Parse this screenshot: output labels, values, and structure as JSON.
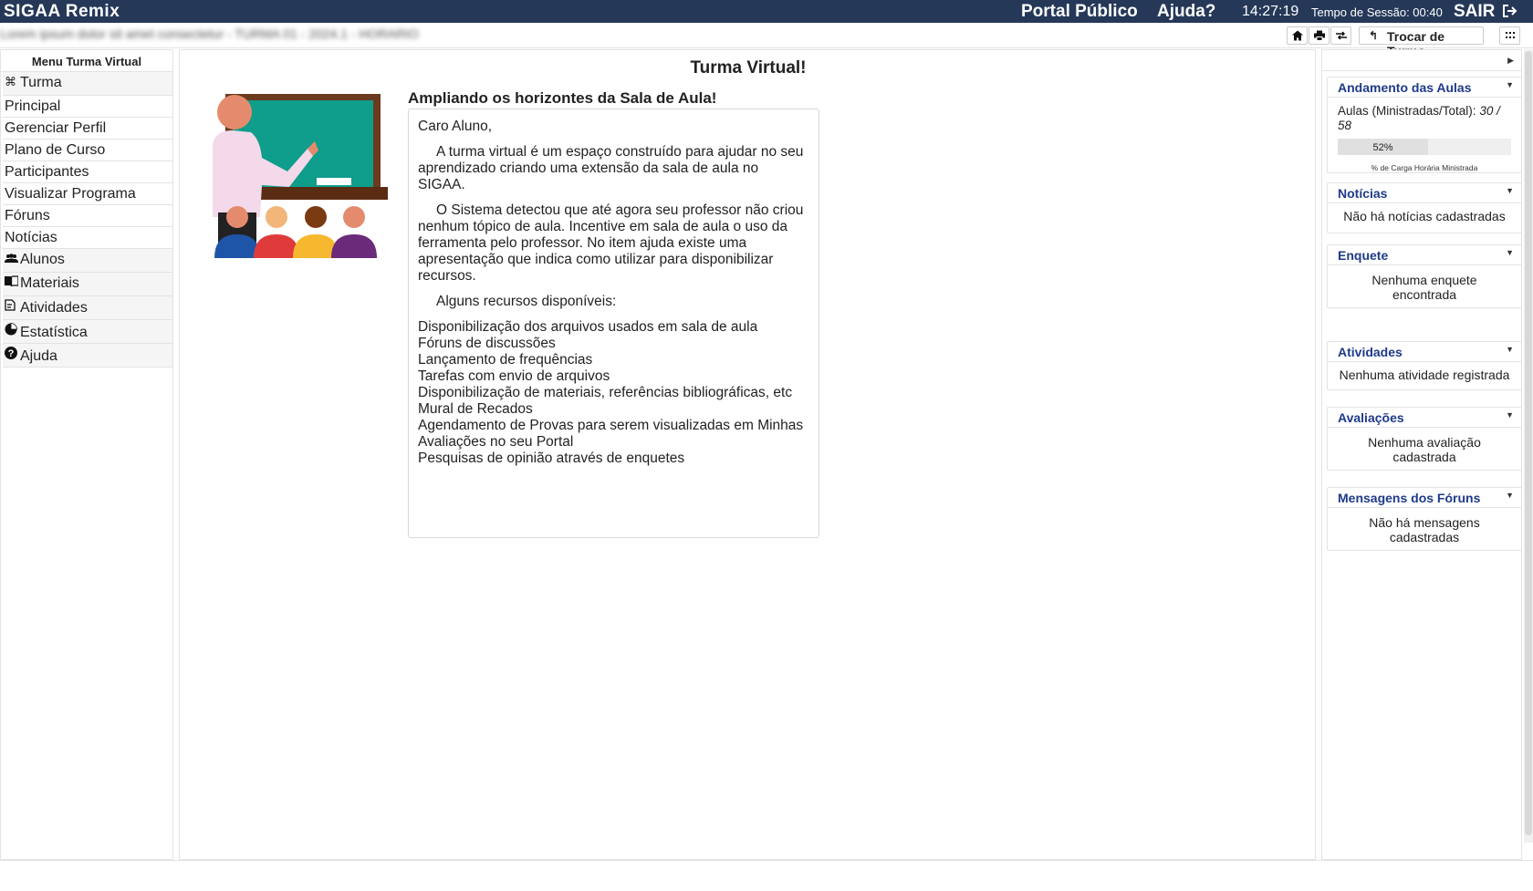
{
  "header": {
    "brand": "SIGAA Remix",
    "portal_link": "Portal Público",
    "help_link": "Ajuda?",
    "clock": "14:27:19",
    "session_label": "Tempo de Sessão: 00:40",
    "logout": "SAIR",
    "background_color": "#253858"
  },
  "subbar": {
    "class_info_blurred": "Lorem ipsum dolor sit amet consectetur - TURMA 01 - 2024.1 - HORARIO",
    "switch_class_label": "Trocar de Turma",
    "icons": [
      "home-icon",
      "print-icon",
      "swap-icon",
      "grid-icon"
    ]
  },
  "menu": {
    "title": "Menu Turma Virtual",
    "items": [
      {
        "label": "Turma",
        "icon": "class-icon",
        "group": true
      },
      {
        "label": "Principal"
      },
      {
        "label": "Gerenciar Perfil"
      },
      {
        "label": "Plano de Curso"
      },
      {
        "label": "Participantes"
      },
      {
        "label": "Visualizar Programa"
      },
      {
        "label": "Fóruns"
      },
      {
        "label": "Notícias"
      },
      {
        "label": "Alunos",
        "icon": "users-icon",
        "group": true
      },
      {
        "label": "Materiais",
        "icon": "book-icon",
        "group": true
      },
      {
        "label": "Atividades",
        "icon": "edit-icon",
        "group": true
      },
      {
        "label": "Estatística",
        "icon": "pie-chart-icon",
        "group": true
      },
      {
        "label": "Ajuda",
        "icon": "question-icon",
        "group": true
      }
    ]
  },
  "main": {
    "title": "Turma Virtual!",
    "subtitle": "Ampliando os horizontes da Sala de Aula!",
    "greeting": "Caro Aluno,",
    "para1": "A turma virtual é um espaço construído para ajudar no seu aprendizado criando uma extensão da sala de aula no SIGAA.",
    "para2": "O Sistema detectou que até agora seu professor não criou nenhum tópico de aula. Incentive em sala de aula o uso da ferramenta pelo professor. No item ajuda existe uma apresentação que indica como utilizar para disponibilizar recursos.",
    "para3": "Alguns recursos disponíveis:",
    "resources": [
      "Disponibilização dos arquivos usados em sala de aula",
      "Fóruns de discussões",
      "Lançamento de frequências",
      "Tarefas com envio de arquivos",
      "Disponibilização de materiais, referências bibliográficas, etc",
      "Mural de Recados",
      "Agendamento de Provas para serem visualizadas em Minhas Avaliações no seu Portal",
      "Pesquisas de opinião através de enquetes"
    ]
  },
  "sidebar": {
    "andamento": {
      "title": "Andamento das Aulas",
      "label": "Aulas (Ministradas/Total):",
      "value": "30 / 58",
      "progress_label": "52%",
      "progress_fraction": 0.52,
      "caption": "% de Carga Horária Ministrada"
    },
    "noticias": {
      "title": "Notícias",
      "body": "Não há notícias cadastradas"
    },
    "enquete": {
      "title": "Enquete",
      "body": "Nenhuma enquete encontrada"
    },
    "atividades": {
      "title": "Atividades",
      "body": "Nenhuma atividade registrada"
    },
    "avaliacoes": {
      "title": "Avaliações",
      "body": "Nenhuma avaliação cadastrada"
    },
    "mensagens": {
      "title": "Mensagens dos Fóruns",
      "body": "Não há mensagens cadastradas"
    }
  }
}
